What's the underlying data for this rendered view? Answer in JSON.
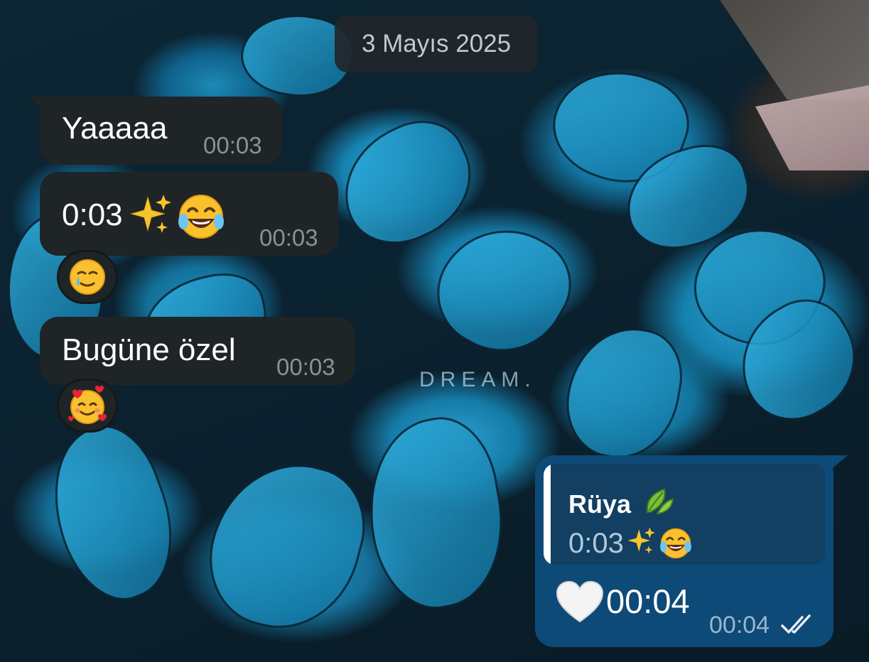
{
  "chat": {
    "date_separator": "3 Mayıs 2025",
    "wallpaper_watermark": "DREAM.",
    "messages": [
      {
        "text": "Yaaaaa",
        "time": "00:03"
      },
      {
        "text": "0:03",
        "time": "00:03",
        "reaction": "face-with-tear-icon"
      },
      {
        "text": "Bugüne özel",
        "time": "00:03",
        "reaction": "smiling-face-with-hearts-icon"
      }
    ],
    "outgoing": {
      "reply_name": "Rüya",
      "reply_text": "0:03",
      "text": "00:04",
      "time": "00:04",
      "status": "double-check-icon"
    }
  },
  "colors": {
    "incoming_bubble": "#1f2427",
    "outgoing_bubble": "#0e4a77",
    "reply_card": "#123f62",
    "timestamp": "#8b9297"
  }
}
